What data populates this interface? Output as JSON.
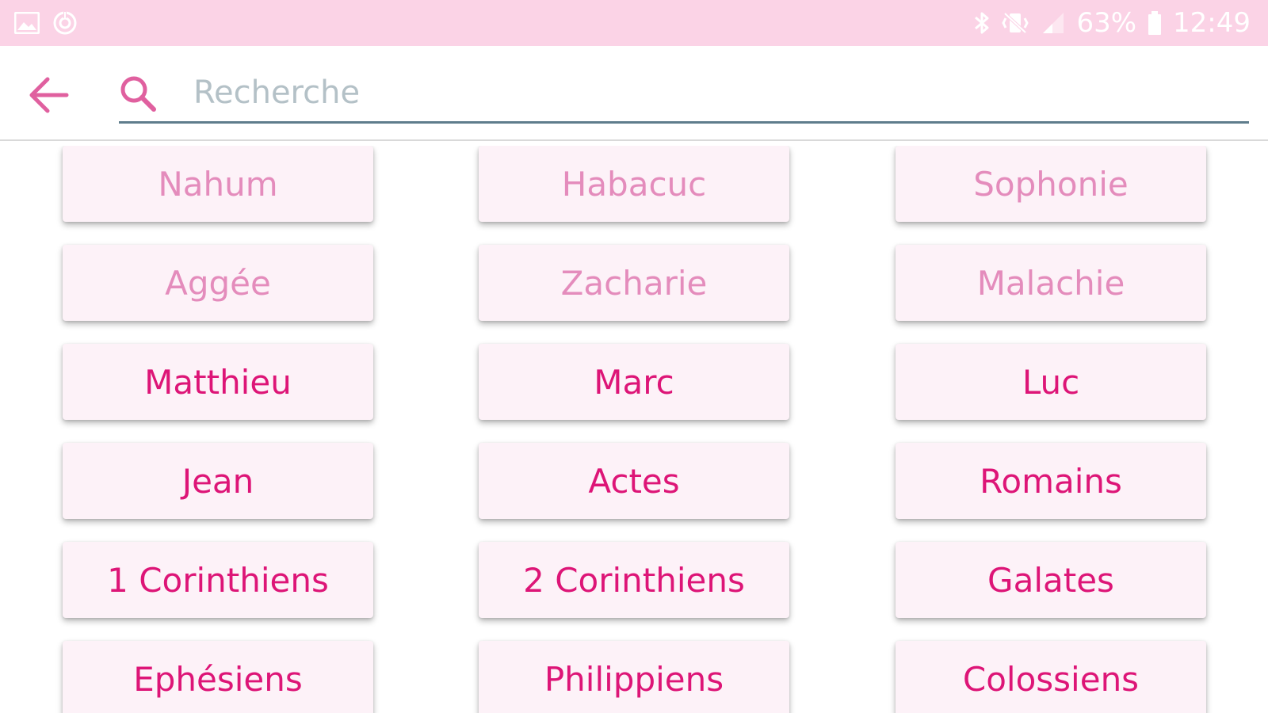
{
  "status_bar": {
    "battery": "63%",
    "time": "12:49"
  },
  "search": {
    "placeholder": "Recherche",
    "value": ""
  },
  "colors": {
    "status_bar_bg": "#fbd3e6",
    "accent": "#dd1577",
    "accent_dim": "#e48cbc",
    "tile_bg": "#fdf2f8",
    "back_arrow": "#e0609f",
    "search_icon": "#e0609f"
  },
  "books": [
    {
      "label": "Nahum",
      "style": "dim"
    },
    {
      "label": "Habacuc",
      "style": "dim"
    },
    {
      "label": "Sophonie",
      "style": "dim"
    },
    {
      "label": "Aggée",
      "style": "dim"
    },
    {
      "label": "Zacharie",
      "style": "dim"
    },
    {
      "label": "Malachie",
      "style": "dim"
    },
    {
      "label": "Matthieu",
      "style": "bold"
    },
    {
      "label": "Marc",
      "style": "bold"
    },
    {
      "label": "Luc",
      "style": "bold"
    },
    {
      "label": "Jean",
      "style": "bold"
    },
    {
      "label": "Actes",
      "style": "bold"
    },
    {
      "label": "Romains",
      "style": "bold"
    },
    {
      "label": "1 Corinthiens",
      "style": "bold"
    },
    {
      "label": "2 Corinthiens",
      "style": "bold"
    },
    {
      "label": "Galates",
      "style": "bold"
    },
    {
      "label": "Ephésiens",
      "style": "bold"
    },
    {
      "label": "Philippiens",
      "style": "bold"
    },
    {
      "label": "Colossiens",
      "style": "bold"
    }
  ],
  "icons": {
    "back": "arrow-left-icon",
    "search": "search-icon",
    "gallery": "image-icon",
    "sync": "sync-icon",
    "bluetooth": "bluetooth-icon",
    "vibrate": "vibrate-icon",
    "signal": "signal-icon",
    "battery": "battery-icon"
  }
}
